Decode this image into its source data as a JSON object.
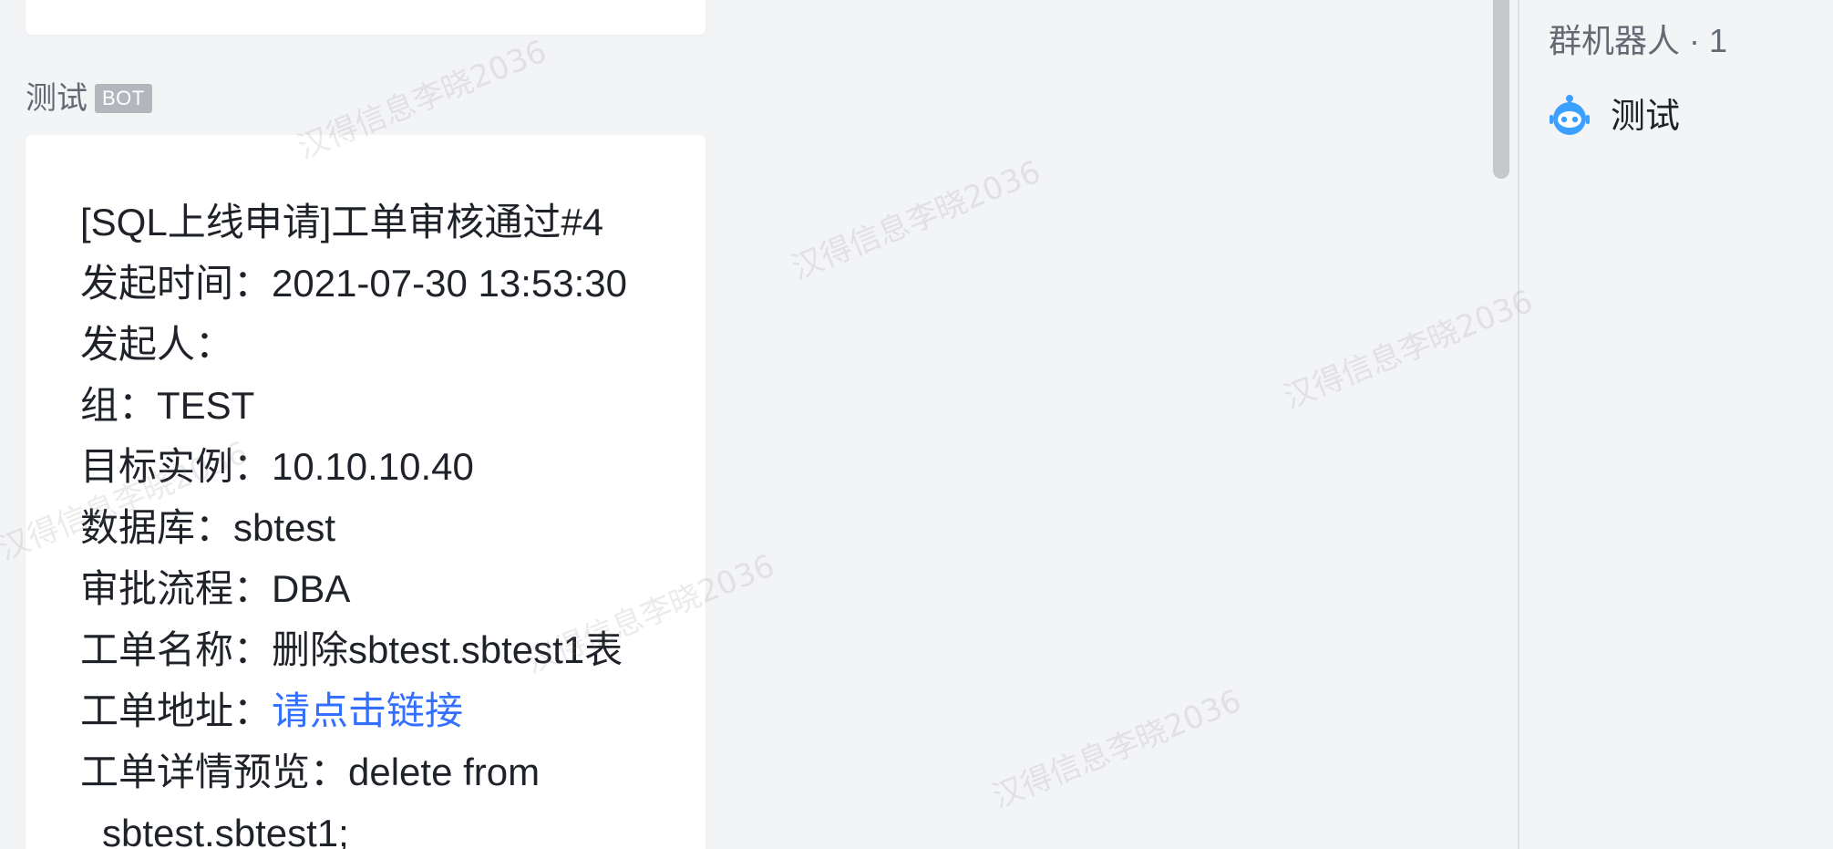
{
  "chat": {
    "message": {
      "sender_name": "测试",
      "sender_badge": "BOT",
      "lines": [
        "[SQL上线申请]工单审核通过#4",
        "发起时间：2021-07-30 13:53:30",
        "发起人：",
        "组：TEST",
        "目标实例：10.10.10.40",
        "数据库：sbtest",
        "审批流程：DBA",
        "工单名称：删除sbtest.sbtest1表"
      ],
      "link_prefix": "工单地址：",
      "link_text": "请点击链接",
      "preview_prefix": "工单详情预览：delete from",
      "preview_continuation": "sbtest.sbtest1;"
    }
  },
  "side_panel": {
    "header": "群机器人 · 1",
    "bots": [
      {
        "name": "测试",
        "icon": "robot-icon"
      }
    ]
  },
  "watermark": {
    "text": "汉得信息李晓2036"
  },
  "colors": {
    "background": "#f3f4f6",
    "bubble": "#ffffff",
    "link": "#3370ff",
    "badge": "#b3b7bd",
    "robot_icon": "#3ba0ff"
  }
}
